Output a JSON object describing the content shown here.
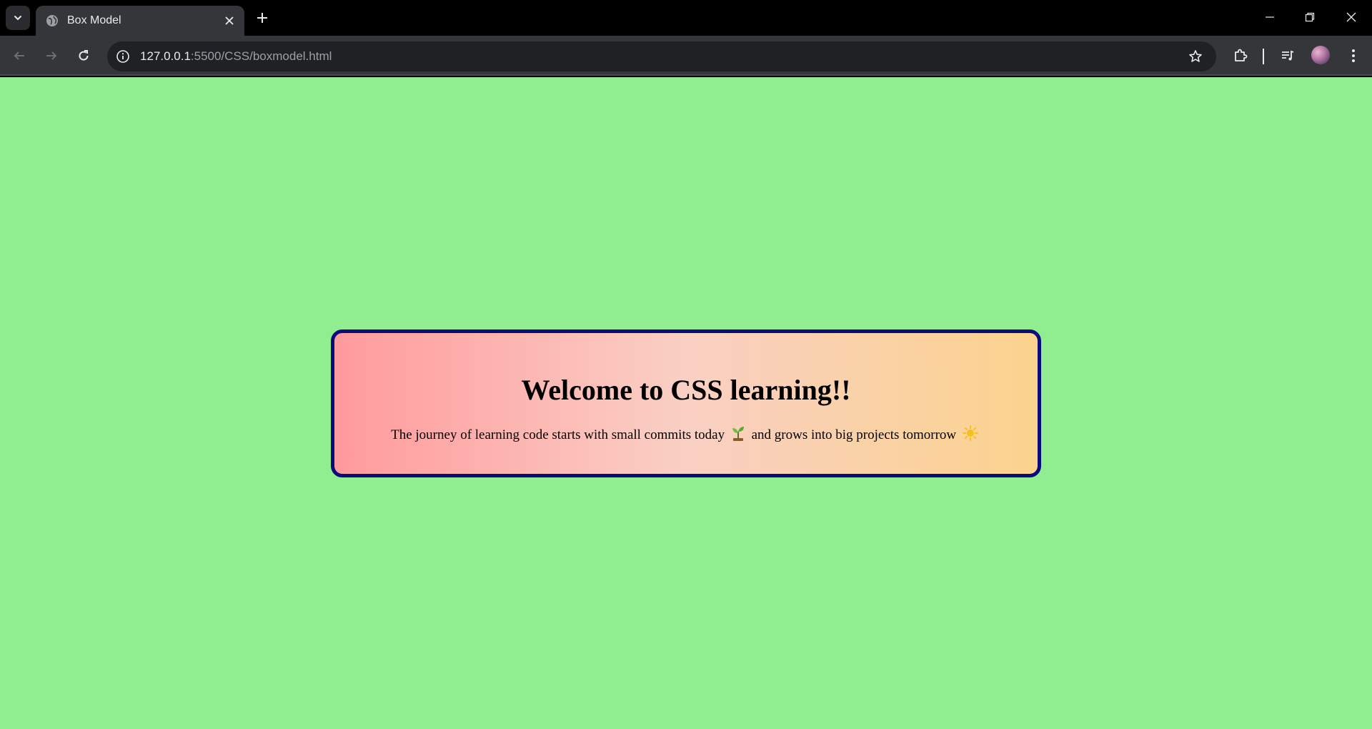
{
  "browser": {
    "tab": {
      "title": "Box Model"
    },
    "address_bar": {
      "host": "127.0.0.1",
      "path": ":5500/CSS/boxmodel.html"
    }
  },
  "page": {
    "background_color": "#90ee90",
    "card": {
      "title": "Welcome to CSS learning!!",
      "text_part1": "The journey of learning code starts with small commits today",
      "text_part2": "and grows into big projects tomorrow",
      "emoji_1": "seedling-icon",
      "emoji_2": "sun-icon",
      "border_color": "#0a0a7a",
      "gradient": [
        "#ff9a9e",
        "#fad0c4",
        "#fbd38d"
      ]
    }
  }
}
